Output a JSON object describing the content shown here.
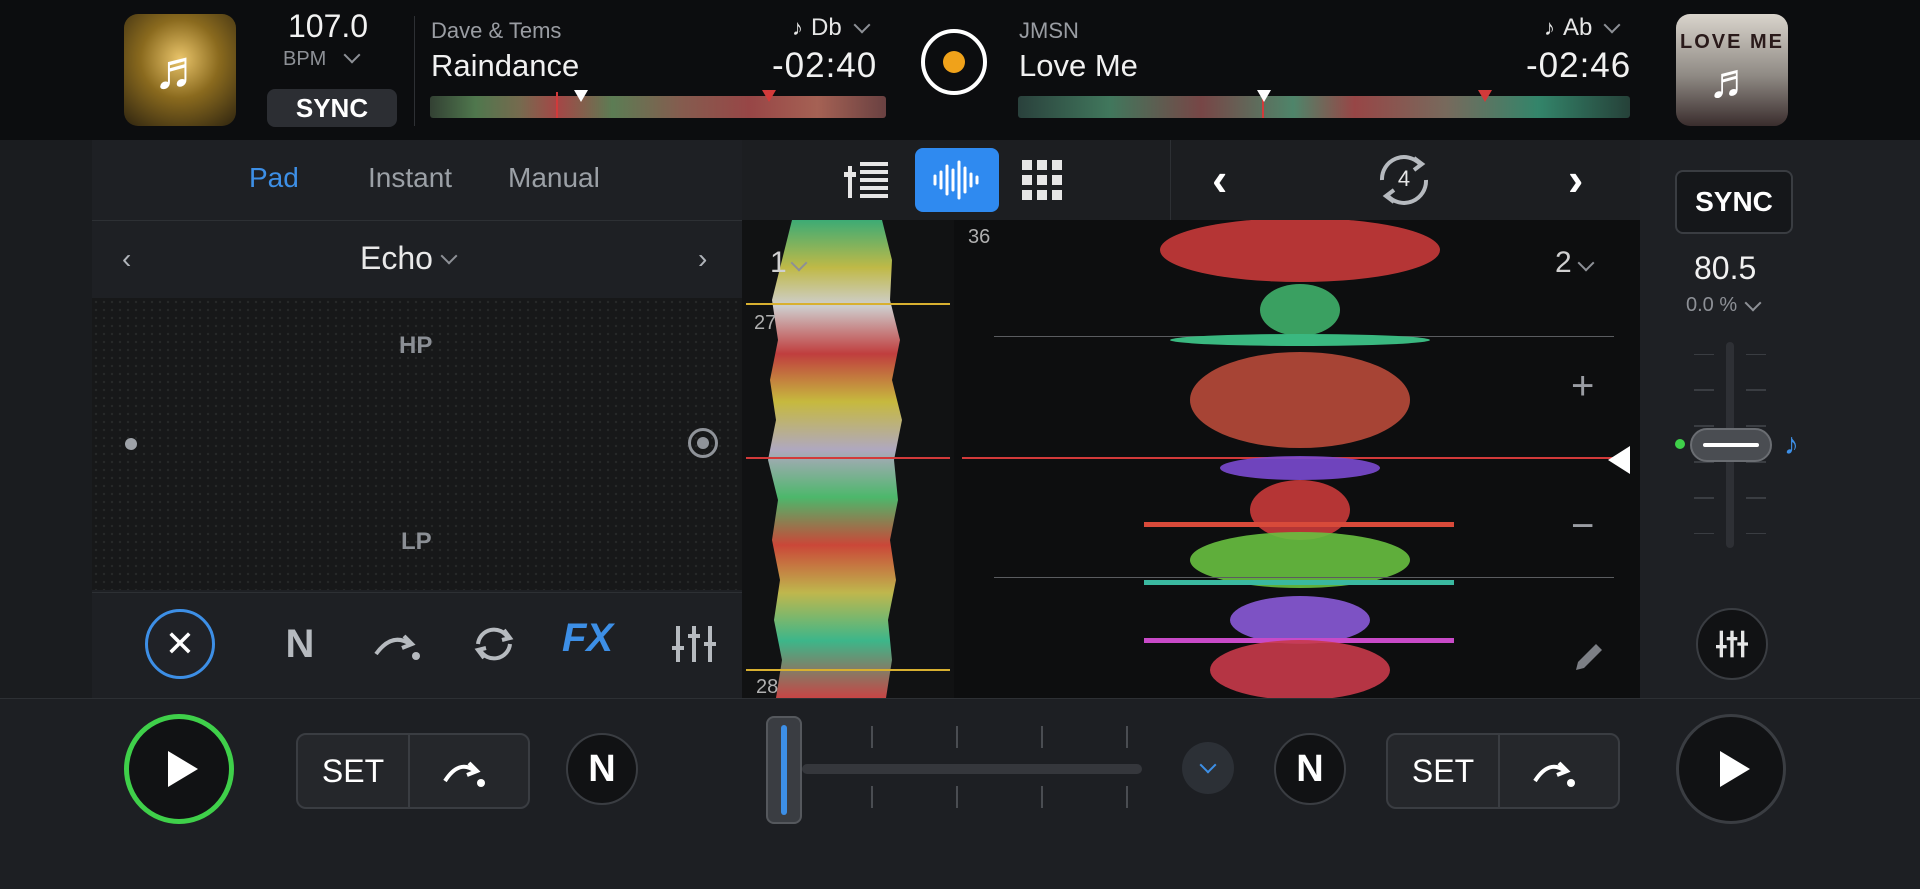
{
  "colors": {
    "accent": "#3d8fe6",
    "play_left_ring": "#3fd04a",
    "disc": "#f0a21a",
    "playhead": "#d23a3a"
  },
  "deck_left": {
    "bpm": "107.0",
    "bpm_label": "BPM",
    "sync_label": "SYNC",
    "artist": "Dave & Tems",
    "title": "Raindance",
    "key": "Db",
    "key_icon": "♪",
    "time": "-02:40",
    "art_icon": "♬"
  },
  "deck_right": {
    "artist": "JMSN",
    "title": "Love Me",
    "key": "Ab",
    "key_icon": "♪",
    "time": "-02:46",
    "art_icon": "♬",
    "art_text": "LOVE ME",
    "sync_label": "SYNC",
    "tempo": "80.5",
    "pitch": "0.0 %"
  },
  "fx_tabs": [
    {
      "label": "Pad"
    },
    {
      "label": "Instant"
    },
    {
      "label": "Manual"
    }
  ],
  "fx": {
    "name": "Echo",
    "hp_label": "HP",
    "lp_label": "LP",
    "fx_button": "FX"
  },
  "loop": {
    "value": "4"
  },
  "wave": {
    "deck1_label": "1",
    "deck2_label": "2",
    "bar_top_left": "27",
    "bar_bottom_left": "28",
    "bar_top_right": "36",
    "plus": "+",
    "minus": "−"
  },
  "bottom": {
    "set_label": "SET",
    "set_label_right": "SET",
    "n_label": "N"
  }
}
